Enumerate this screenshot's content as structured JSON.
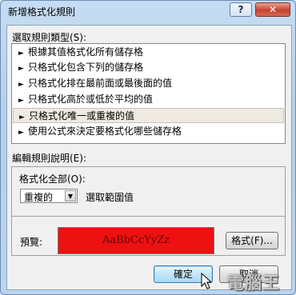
{
  "window": {
    "title": "新增格式化規則",
    "help_label": "?",
    "close_label": "✕"
  },
  "rule_type": {
    "label": "選取規則類型(S):",
    "items": [
      {
        "label": "根據其值格式化所有儲存格"
      },
      {
        "label": "只格式化包含下列的儲存格"
      },
      {
        "label": "只格式化排在最前面或最後面的值"
      },
      {
        "label": "只格式化高於或低於平均的值"
      },
      {
        "label": "只格式化唯一或重複的值",
        "selected": true
      },
      {
        "label": "使用公式來決定要格式化哪些儲存格"
      }
    ],
    "bullet": "►"
  },
  "edit_rule": {
    "label": "編輯規則說明(E):",
    "format_all_label": "格式化全部(O):",
    "combo_value": "重複的",
    "combo_suffix": "選取範圍值",
    "preview_label": "預覽:",
    "preview_text": "AaBbCcYyZz",
    "format_button": "格式(F)...",
    "preview_color": "#ee1111"
  },
  "footer": {
    "ok_label": "確定",
    "cancel_label": "取消"
  },
  "watermark": "電腦王"
}
